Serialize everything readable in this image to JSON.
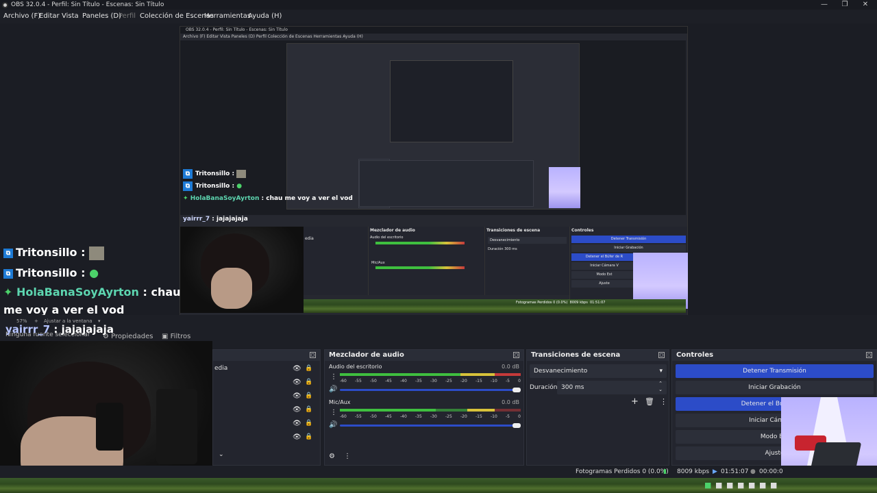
{
  "window": {
    "title": "OBS 32.0.4 - Perfil: Sin Título - Escenas: Sin Título",
    "controls": {
      "minimize": "—",
      "restore": "❐",
      "close": "✕"
    }
  },
  "menu": {
    "items": [
      "Archivo (F)",
      "Editar",
      "Vista",
      "Paneles (D)",
      "Perfil",
      "Colección de Escenas",
      "Herramientas",
      "Ayuda (H)"
    ]
  },
  "nested_preview": {
    "title": "OBS 32.0.4 - Perfil: Sin Título - Escenas: Sin Título",
    "menu": "Archivo (F)   Editar   Vista   Paneles (D)   Perfil   Colección de Escenas   Herramientas   Ayuda (H)",
    "mini_docks": {
      "mixer": "Mezclador de audio",
      "desktop": "Audio del escritorio",
      "mic": "Mic/Aux",
      "transitions": "Transiciones de escena",
      "fade": "Desvanecimiento",
      "duration_label": "Duración",
      "duration": "300 ms",
      "controls": "Controles",
      "stop_stream": "Detener Transmisión",
      "start_record": "Iniciar Grabación",
      "stop_buffer": "Detener el Búfer de R",
      "virtual_cam": "Iniciar Cámara V",
      "studio": "Modo Est",
      "settings": "Ajuste",
      "status": "Fotogramas Perdidos 0 (0.0%)",
      "kbps": "8009 kbps",
      "time": "01:51:07",
      "time2": "00:00:0",
      "zoom": "57%",
      "fit": "Ajustar a la ventana",
      "no_source": "Ninguna fuente seleccionada",
      "props": "Propiedades",
      "filters": "Filtros",
      "media_fragment": "edia"
    }
  },
  "chat": {
    "messages": [
      {
        "user": "Tritonsillo",
        "text": ":",
        "icon": "prime-icon"
      },
      {
        "user": "Tritonsillo",
        "text": ":",
        "icon": "prime-icon"
      },
      {
        "user": "HolaBanaSoyAyrton",
        "text": ": chau me voy a ver el vod",
        "icon": "diamond-icon"
      },
      {
        "user": "yairrr_7",
        "text": ": jajajajaja",
        "icon": ""
      }
    ]
  },
  "preview_bar": {
    "zoom": "57%",
    "plus": "+",
    "fit_label": "Ajustar a la ventana"
  },
  "source_bar": {
    "no_source": "Ninguna fuente seleccionar",
    "properties": "Propiedades",
    "filters": "Filtros"
  },
  "sources_dock": {
    "partial_label": "edia"
  },
  "mixer": {
    "title": "Mezclador de audio",
    "channels": [
      {
        "name": "Audio del escritorio",
        "db": "0.0 dB"
      },
      {
        "name": "Mic/Aux",
        "db": "0.0 dB"
      }
    ],
    "ticks": [
      "-60",
      "-55",
      "-50",
      "-45",
      "-40",
      "-35",
      "-30",
      "-25",
      "-20",
      "-15",
      "-10",
      "-5",
      "0"
    ]
  },
  "transitions": {
    "title": "Transiciones de escena",
    "selected": "Desvanecimiento",
    "duration_label": "Duración",
    "duration_value": "300 ms"
  },
  "controls": {
    "title": "Controles",
    "buttons": [
      {
        "label": "Detener Transmisión",
        "active": true
      },
      {
        "label": "Iniciar Grabación",
        "active": false
      },
      {
        "label": "Detener el Búfer de R",
        "active": true
      },
      {
        "label": "Iniciar Cámara V",
        "active": false
      },
      {
        "label": "Modo Est",
        "active": false
      },
      {
        "label": "Ajuste",
        "active": false
      }
    ]
  },
  "status": {
    "dropped_frames": "Fotogramas Perdidos 0 (0.0%)",
    "bitrate": "8009 kbps",
    "stream_time": "01:51:07",
    "record_time": "00:00:0"
  },
  "colors": {
    "accent": "#2c4cc8",
    "meter_green": "#3fbf3f",
    "meter_yellow": "#d8c23a",
    "meter_red": "#c53a3a",
    "chat_name": "#5dd6b0"
  }
}
